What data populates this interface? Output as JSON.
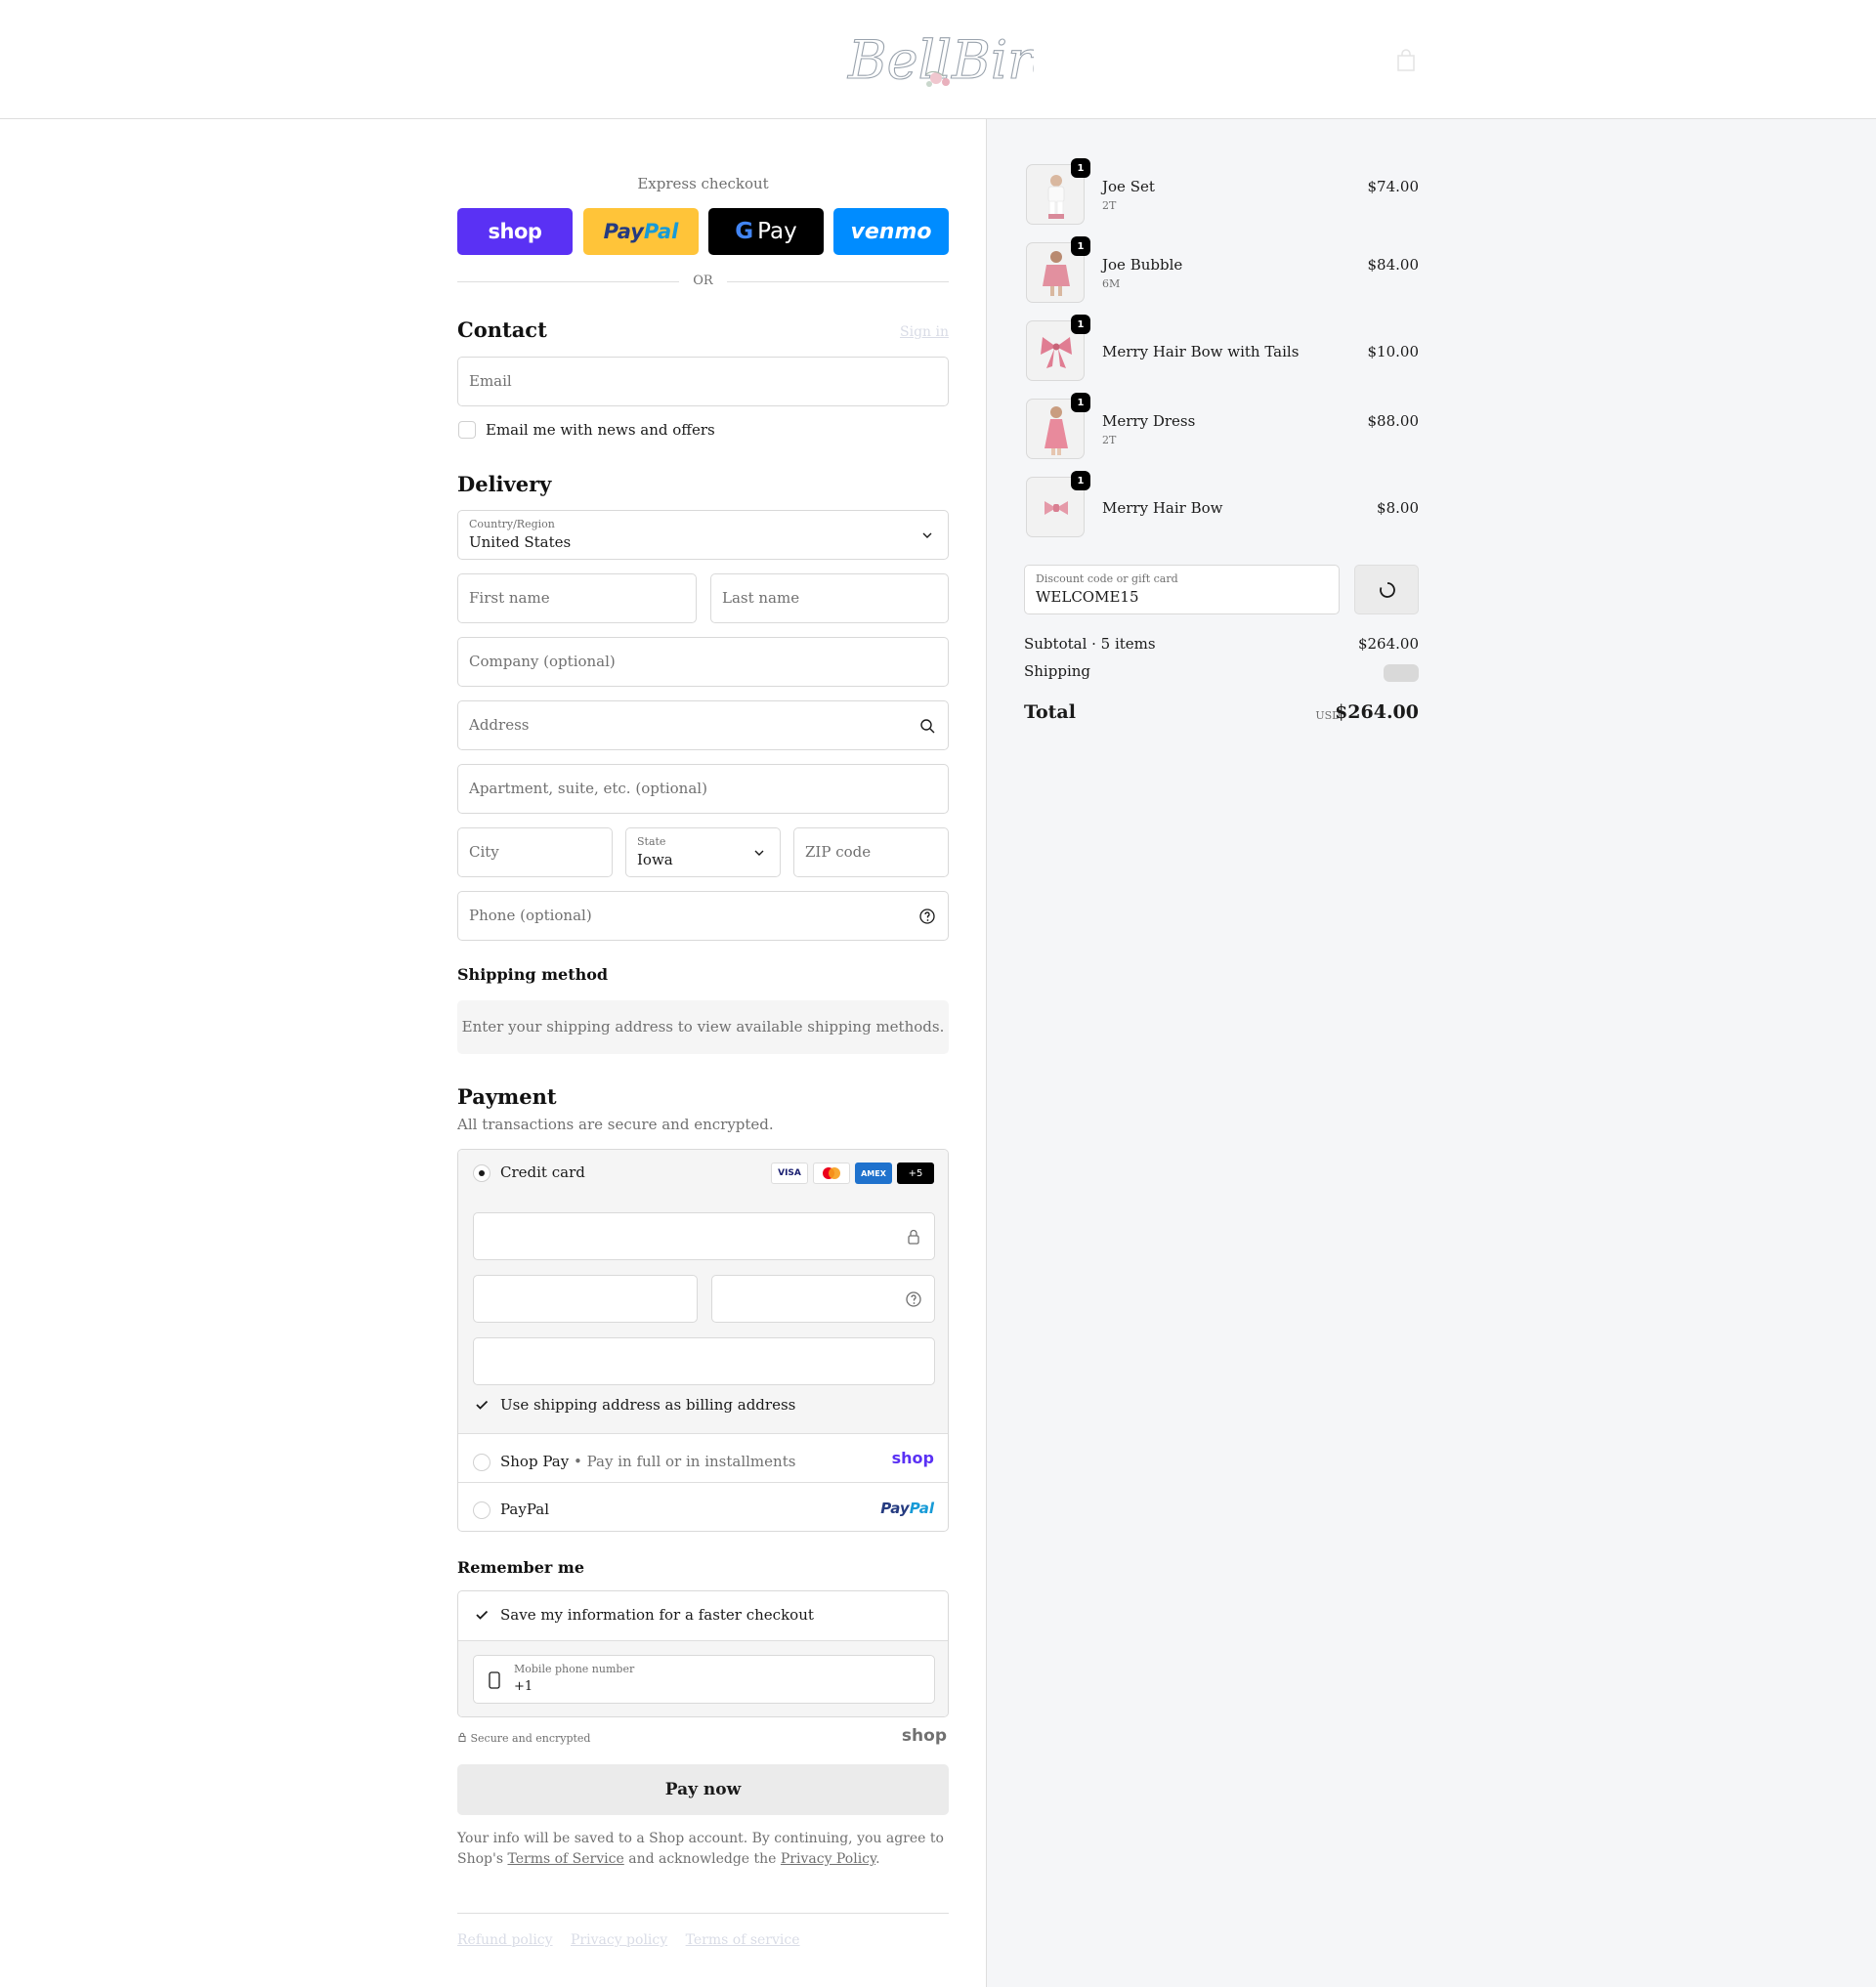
{
  "header": {
    "logo_text": "BellBird",
    "cart_icon": "shopping-bag-icon"
  },
  "express": {
    "title": "Express checkout",
    "shop_label": "shop",
    "paypal_label_1": "Pay",
    "paypal_label_2": "Pal",
    "gpay_g": "G",
    "gpay_label": "Pay",
    "venmo_label": "venmo",
    "or_label": "OR"
  },
  "contact": {
    "title": "Contact",
    "sign_in": "Sign in",
    "email_placeholder": "Email",
    "news_label": "Email me with news and offers"
  },
  "delivery": {
    "title": "Delivery",
    "country_label": "Country/Region",
    "country_value": "United States",
    "first_name": "First name",
    "last_name": "Last name",
    "company": "Company (optional)",
    "address": "Address",
    "apartment": "Apartment, suite, etc. (optional)",
    "city": "City",
    "state_label": "State",
    "state_value": "Iowa",
    "zip": "ZIP code",
    "phone": "Phone (optional)"
  },
  "shipping": {
    "title": "Shipping method",
    "message": "Enter your shipping address to view available shipping methods."
  },
  "payment": {
    "title": "Payment",
    "description": "All transactions are secure and encrypted.",
    "credit_card": "Credit card",
    "card_brands": [
      "VISA",
      "MC",
      "AMEX",
      "+5"
    ],
    "billing_label": "Use shipping address as billing address",
    "shop_pay": "Shop Pay",
    "shop_pay_sep": "•",
    "shop_pay_desc": "Pay in full or in installments",
    "shop_pay_logo": "shop",
    "paypal": "PayPal",
    "paypal_logo_1": "Pay",
    "paypal_logo_2": "Pal"
  },
  "remember": {
    "title": "Remember me",
    "save_label": "Save my information for a faster checkout",
    "mobile_label": "Mobile phone number",
    "mobile_value": "+1"
  },
  "footer": {
    "secure": "Secure and encrypted",
    "shop_logo": "shop",
    "pay_now": "Pay now",
    "legal_1": "Your info will be saved to a Shop account. By continuing, you agree to Shop's ",
    "terms": "Terms of Service",
    "legal_2": " and acknowledge the ",
    "privacy": "Privacy Policy",
    "legal_3": ".",
    "links": [
      "Refund policy",
      "Privacy policy",
      "Terms of service"
    ]
  },
  "order": {
    "items": [
      {
        "name": "Joe Set",
        "variant": "2T",
        "price": "$74.00",
        "qty": "1"
      },
      {
        "name": "Joe Bubble",
        "variant": "6M",
        "price": "$84.00",
        "qty": "1"
      },
      {
        "name": "Merry Hair Bow with Tails",
        "variant": "",
        "price": "$10.00",
        "qty": "1"
      },
      {
        "name": "Merry Dress",
        "variant": "2T",
        "price": "$88.00",
        "qty": "1"
      },
      {
        "name": "Merry Hair Bow",
        "variant": "",
        "price": "$8.00",
        "qty": "1"
      }
    ],
    "discount_label": "Discount code or gift card",
    "discount_value": "WELCOME15",
    "subtotal_label": "Subtotal · 5 items",
    "subtotal_value": "$264.00",
    "shipping_label": "Shipping",
    "total_label": "Total",
    "currency": "USD",
    "total_value": "$264.00"
  },
  "colors": {
    "shop_purple": "#5a31f4",
    "paypal_yellow": "#ffc439",
    "venmo_blue": "#008cff",
    "sidebar_bg": "#f5f6f8"
  }
}
